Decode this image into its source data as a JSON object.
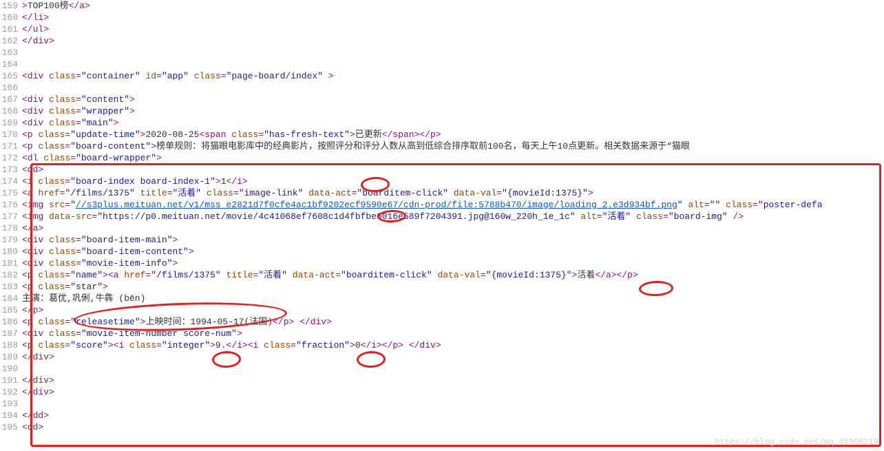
{
  "watermark": "https://blog.csdn.net/qq_45906219",
  "lines": [
    {
      "no": 159,
      "indent": 8,
      "tokens": [
        {
          "c": "t-tag",
          "t": ">"
        },
        {
          "c": "t-txt",
          "t": "TOP100榜"
        },
        {
          "c": "t-tag",
          "t": "</a>"
        }
      ]
    },
    {
      "no": 160,
      "indent": 4,
      "tokens": [
        {
          "c": "t-tag",
          "t": "</li>"
        }
      ]
    },
    {
      "no": 161,
      "indent": 2,
      "tokens": [
        {
          "c": "t-tag",
          "t": "</ul>"
        }
      ]
    },
    {
      "no": 162,
      "indent": 1,
      "tokens": [
        {
          "c": "t-tag",
          "t": "</div>"
        }
      ]
    },
    {
      "no": 163,
      "indent": 0,
      "tokens": []
    },
    {
      "no": 164,
      "indent": 0,
      "tokens": []
    },
    {
      "no": 165,
      "indent": 4,
      "tokens": [
        {
          "c": "t-tag",
          "t": "<div "
        },
        {
          "c": "t-attr",
          "t": "class"
        },
        {
          "c": "t-tag",
          "t": "="
        },
        {
          "c": "t-str",
          "t": "\"container\""
        },
        {
          "c": "t-tag",
          "t": " "
        },
        {
          "c": "t-attr",
          "t": "id"
        },
        {
          "c": "t-tag",
          "t": "="
        },
        {
          "c": "t-str",
          "t": "\"app\""
        },
        {
          "c": "t-tag",
          "t": " "
        },
        {
          "c": "t-attr",
          "t": "class"
        },
        {
          "c": "t-tag",
          "t": "="
        },
        {
          "c": "t-str",
          "t": "\"page-board/index\""
        },
        {
          "c": "t-tag",
          "t": " >"
        }
      ]
    },
    {
      "no": 166,
      "indent": 0,
      "tokens": []
    },
    {
      "no": 167,
      "indent": 1,
      "tokens": [
        {
          "c": "t-tag",
          "t": "<div "
        },
        {
          "c": "t-attr",
          "t": "class"
        },
        {
          "c": "t-tag",
          "t": "="
        },
        {
          "c": "t-str",
          "t": "\"content\""
        },
        {
          "c": "t-tag",
          "t": ">"
        }
      ]
    },
    {
      "no": 168,
      "indent": 4,
      "tokens": [
        {
          "c": "t-tag",
          "t": "<div "
        },
        {
          "c": "t-attr",
          "t": "class"
        },
        {
          "c": "t-tag",
          "t": "="
        },
        {
          "c": "t-str",
          "t": "\"wrapper\""
        },
        {
          "c": "t-tag",
          "t": ">"
        }
      ]
    },
    {
      "no": 169,
      "indent": 6,
      "tokens": [
        {
          "c": "t-tag",
          "t": "<div "
        },
        {
          "c": "t-attr",
          "t": "class"
        },
        {
          "c": "t-tag",
          "t": "="
        },
        {
          "c": "t-str",
          "t": "\"main\""
        },
        {
          "c": "t-tag",
          "t": ">"
        }
      ]
    },
    {
      "no": 170,
      "indent": 8,
      "tokens": [
        {
          "c": "t-tag",
          "t": "<p "
        },
        {
          "c": "t-attr",
          "t": "class"
        },
        {
          "c": "t-tag",
          "t": "="
        },
        {
          "c": "t-str",
          "t": "\"update-time\""
        },
        {
          "c": "t-tag",
          "t": ">"
        },
        {
          "c": "t-txt",
          "t": "2020-08-25"
        },
        {
          "c": "t-tag",
          "t": "<span "
        },
        {
          "c": "t-attr",
          "t": "class"
        },
        {
          "c": "t-tag",
          "t": "="
        },
        {
          "c": "t-str",
          "t": "\"has-fresh-text\""
        },
        {
          "c": "t-tag",
          "t": ">"
        },
        {
          "c": "t-txt",
          "t": "已更新"
        },
        {
          "c": "t-tag",
          "t": "</span></p>"
        }
      ]
    },
    {
      "no": 171,
      "indent": 8,
      "tokens": [
        {
          "c": "t-tag",
          "t": "<p "
        },
        {
          "c": "t-attr",
          "t": "class"
        },
        {
          "c": "t-tag",
          "t": "="
        },
        {
          "c": "t-str",
          "t": "\"board-content\""
        },
        {
          "c": "t-tag",
          "t": ">"
        },
        {
          "c": "t-txt",
          "t": "榜单规则：将猫眼电影库中的经典影片，按照评分和评分人数从高到低综合排序取前100名，每天上午10点更新。相关数据来源于“猫眼"
        }
      ]
    },
    {
      "no": 172,
      "indent": 8,
      "tokens": [
        {
          "c": "t-tag",
          "t": "<dl "
        },
        {
          "c": "t-attr",
          "t": "class"
        },
        {
          "c": "t-tag",
          "t": "="
        },
        {
          "c": "t-str",
          "t": "\"board-wrapper\""
        },
        {
          "c": "t-tag",
          "t": ">"
        }
      ]
    },
    {
      "no": 173,
      "indent": 10,
      "tokens": [
        {
          "c": "t-tag",
          "t": "<dd>"
        }
      ]
    },
    {
      "no": 174,
      "indent": 14,
      "tokens": [
        {
          "c": "t-tag",
          "t": "<i "
        },
        {
          "c": "t-attr",
          "t": "class"
        },
        {
          "c": "t-tag",
          "t": "="
        },
        {
          "c": "t-str",
          "t": "\"board-index board-index-1\""
        },
        {
          "c": "t-tag",
          "t": ">"
        },
        {
          "c": "t-txt",
          "t": "1"
        },
        {
          "c": "t-tag",
          "t": "</i>"
        }
      ]
    },
    {
      "no": 175,
      "indent": 2,
      "tokens": [
        {
          "c": "t-tag",
          "t": "<a "
        },
        {
          "c": "t-attr",
          "t": "href"
        },
        {
          "c": "t-tag",
          "t": "="
        },
        {
          "c": "t-str",
          "t": "\"/films/1375\""
        },
        {
          "c": "t-tag",
          "t": " "
        },
        {
          "c": "t-attr",
          "t": "title"
        },
        {
          "c": "t-tag",
          "t": "="
        },
        {
          "c": "t-str",
          "t": "\"活着\""
        },
        {
          "c": "t-tag",
          "t": " "
        },
        {
          "c": "t-attr",
          "t": "class"
        },
        {
          "c": "t-tag",
          "t": "="
        },
        {
          "c": "t-str",
          "t": "\"image-link\""
        },
        {
          "c": "t-tag",
          "t": " "
        },
        {
          "c": "t-attr",
          "t": "data-act"
        },
        {
          "c": "t-tag",
          "t": "="
        },
        {
          "c": "t-str",
          "t": "\"boarditem-click\""
        },
        {
          "c": "t-tag",
          "t": " "
        },
        {
          "c": "t-attr",
          "t": "data-val"
        },
        {
          "c": "t-tag",
          "t": "="
        },
        {
          "c": "t-str",
          "t": "\"{movieId:1375}\""
        },
        {
          "c": "t-tag",
          "t": ">"
        }
      ]
    },
    {
      "no": 176,
      "indent": 4,
      "tokens": [
        {
          "c": "t-tag",
          "t": "<img "
        },
        {
          "c": "t-attr",
          "t": "src"
        },
        {
          "c": "t-tag",
          "t": "="
        },
        {
          "c": "t-str",
          "t": "\""
        },
        {
          "c": "t-link",
          "t": "//s3plus.meituan.net/v1/mss_e2821d7f0cfe4ac1bf9202ecf9590e67/cdn-prod/file:5788b470/image/loading_2.e3d934bf.png"
        },
        {
          "c": "t-str",
          "t": "\""
        },
        {
          "c": "t-tag",
          "t": " "
        },
        {
          "c": "t-attr",
          "t": "alt"
        },
        {
          "c": "t-tag",
          "t": "="
        },
        {
          "c": "t-str",
          "t": "\"\""
        },
        {
          "c": "t-tag",
          "t": " "
        },
        {
          "c": "t-attr",
          "t": "class"
        },
        {
          "c": "t-tag",
          "t": "="
        },
        {
          "c": "t-str",
          "t": "\"poster-defa"
        }
      ]
    },
    {
      "no": 177,
      "indent": 4,
      "tokens": [
        {
          "c": "t-tag",
          "t": "<img "
        },
        {
          "c": "t-attr",
          "t": "data-src"
        },
        {
          "c": "t-tag",
          "t": "="
        },
        {
          "c": "t-str",
          "t": "\"https://p0.meituan.net/movie/4c41068ef7608c1d4fbfbe6016e589f7204391.jpg@160w_220h_1e_1c\""
        },
        {
          "c": "t-tag",
          "t": " "
        },
        {
          "c": "t-attr",
          "t": "alt"
        },
        {
          "c": "t-tag",
          "t": "="
        },
        {
          "c": "t-str",
          "t": "\"活着\""
        },
        {
          "c": "t-tag",
          "t": " "
        },
        {
          "c": "t-attr",
          "t": "class"
        },
        {
          "c": "t-tag",
          "t": "="
        },
        {
          "c": "t-str",
          "t": "\"board-img\""
        },
        {
          "c": "t-tag",
          "t": " />"
        }
      ]
    },
    {
      "no": 178,
      "indent": 2,
      "tokens": [
        {
          "c": "t-tag",
          "t": "</a>"
        }
      ]
    },
    {
      "no": 179,
      "indent": 2,
      "tokens": [
        {
          "c": "t-tag",
          "t": "<div "
        },
        {
          "c": "t-attr",
          "t": "class"
        },
        {
          "c": "t-tag",
          "t": "="
        },
        {
          "c": "t-str",
          "t": "\"board-item-main\""
        },
        {
          "c": "t-tag",
          "t": ">"
        }
      ]
    },
    {
      "no": 180,
      "indent": 4,
      "tokens": [
        {
          "c": "t-tag",
          "t": "<div "
        },
        {
          "c": "t-attr",
          "t": "class"
        },
        {
          "c": "t-tag",
          "t": "="
        },
        {
          "c": "t-str",
          "t": "\"board-item-content\""
        },
        {
          "c": "t-tag",
          "t": ">"
        }
      ]
    },
    {
      "no": 181,
      "indent": 8,
      "tokens": [
        {
          "c": "t-tag",
          "t": "<div "
        },
        {
          "c": "t-attr",
          "t": "class"
        },
        {
          "c": "t-tag",
          "t": "="
        },
        {
          "c": "t-str",
          "t": "\"movie-item-info\""
        },
        {
          "c": "t-tag",
          "t": ">"
        }
      ]
    },
    {
      "no": 182,
      "indent": 4,
      "tokens": [
        {
          "c": "t-tag",
          "t": "<p "
        },
        {
          "c": "t-attr",
          "t": "class"
        },
        {
          "c": "t-tag",
          "t": "="
        },
        {
          "c": "t-str",
          "t": "\"name\""
        },
        {
          "c": "t-tag",
          "t": "><a "
        },
        {
          "c": "t-attr",
          "t": "href"
        },
        {
          "c": "t-tag",
          "t": "="
        },
        {
          "c": "t-str",
          "t": "\"/films/1375\""
        },
        {
          "c": "t-tag",
          "t": " "
        },
        {
          "c": "t-attr",
          "t": "title"
        },
        {
          "c": "t-tag",
          "t": "="
        },
        {
          "c": "t-str",
          "t": "\"活着\""
        },
        {
          "c": "t-tag",
          "t": " "
        },
        {
          "c": "t-attr",
          "t": "data-act"
        },
        {
          "c": "t-tag",
          "t": "="
        },
        {
          "c": "t-str",
          "t": "\"boarditem-click\""
        },
        {
          "c": "t-tag",
          "t": " "
        },
        {
          "c": "t-attr",
          "t": "data-val"
        },
        {
          "c": "t-tag",
          "t": "="
        },
        {
          "c": "t-str",
          "t": "\"{movieId:1375}\""
        },
        {
          "c": "t-tag",
          "t": ">"
        },
        {
          "c": "t-txt",
          "t": "活着"
        },
        {
          "c": "t-tag",
          "t": "</a></p>"
        }
      ]
    },
    {
      "no": 183,
      "indent": 4,
      "tokens": [
        {
          "c": "t-tag",
          "t": "<p "
        },
        {
          "c": "t-attr",
          "t": "class"
        },
        {
          "c": "t-tag",
          "t": "="
        },
        {
          "c": "t-str",
          "t": "\"star\""
        },
        {
          "c": "t-tag",
          "t": ">"
        }
      ]
    },
    {
      "no": 184,
      "indent": 10,
      "tokens": [
        {
          "c": "t-txt",
          "t": "主演：葛优,巩俐,牛犇 (bēn)"
        }
      ]
    },
    {
      "no": 185,
      "indent": 4,
      "tokens": [
        {
          "c": "t-tag",
          "t": "</p>"
        }
      ]
    },
    {
      "no": 186,
      "indent": 0,
      "tokens": [
        {
          "c": "t-tag",
          "t": "<p "
        },
        {
          "c": "t-attr",
          "t": "class"
        },
        {
          "c": "t-tag",
          "t": "="
        },
        {
          "c": "t-str",
          "t": "\"releasetime\""
        },
        {
          "c": "t-tag",
          "t": ">"
        },
        {
          "c": "t-txt",
          "t": "上映时间：1994-05-17(法国)"
        },
        {
          "c": "t-tag",
          "t": "</p>    </div>"
        }
      ]
    },
    {
      "no": 187,
      "indent": 2,
      "tokens": [
        {
          "c": "t-tag",
          "t": "<div "
        },
        {
          "c": "t-attr",
          "t": "class"
        },
        {
          "c": "t-tag",
          "t": "="
        },
        {
          "c": "t-str",
          "t": "\"movie-item-number score-num\""
        },
        {
          "c": "t-tag",
          "t": ">"
        }
      ]
    },
    {
      "no": 188,
      "indent": 0,
      "tokens": [
        {
          "c": "t-tag",
          "t": "<p "
        },
        {
          "c": "t-attr",
          "t": "class"
        },
        {
          "c": "t-tag",
          "t": "="
        },
        {
          "c": "t-str",
          "t": "\"score\""
        },
        {
          "c": "t-tag",
          "t": "><i "
        },
        {
          "c": "t-attr",
          "t": "class"
        },
        {
          "c": "t-tag",
          "t": "="
        },
        {
          "c": "t-str",
          "t": "\"integer\""
        },
        {
          "c": "t-tag",
          "t": ">"
        },
        {
          "c": "t-txt",
          "t": "9."
        },
        {
          "c": "t-tag",
          "t": "</i><i "
        },
        {
          "c": "t-attr",
          "t": "class"
        },
        {
          "c": "t-tag",
          "t": "="
        },
        {
          "c": "t-str",
          "t": "\"fraction\""
        },
        {
          "c": "t-tag",
          "t": ">"
        },
        {
          "c": "t-txt",
          "t": "0"
        },
        {
          "c": "t-tag",
          "t": "</i></p>        </div>"
        }
      ]
    },
    {
      "no": 189,
      "indent": 4,
      "tokens": [
        {
          "c": "t-tag",
          "t": "</div>"
        }
      ]
    },
    {
      "no": 190,
      "indent": 0,
      "tokens": []
    },
    {
      "no": 191,
      "indent": 6,
      "tokens": [
        {
          "c": "t-tag",
          "t": "</div>"
        }
      ]
    },
    {
      "no": 192,
      "indent": 4,
      "tokens": [
        {
          "c": "t-tag",
          "t": "</div>"
        }
      ]
    },
    {
      "no": 193,
      "indent": 0,
      "tokens": []
    },
    {
      "no": 194,
      "indent": 10,
      "tokens": [
        {
          "c": "t-tag",
          "t": "</dd>"
        }
      ]
    },
    {
      "no": 195,
      "indent": 10,
      "tokens": [
        {
          "c": "t-tag",
          "t": "<dd>"
        }
      ]
    }
  ]
}
